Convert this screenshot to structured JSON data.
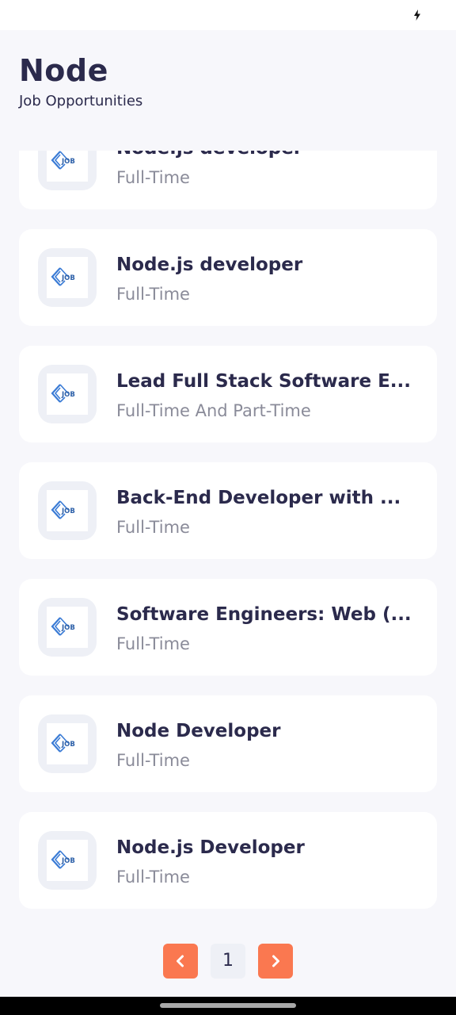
{
  "status_bar": {
    "icon": "charging-bolt-icon"
  },
  "header": {
    "title": "Node",
    "subtitle": "Job Opportunities"
  },
  "jobs": [
    {
      "title": "Node.js developer",
      "type": "Full-Time",
      "logo": "job-logo-icon"
    },
    {
      "title": "Node.js developer",
      "type": "Full-Time",
      "logo": "job-logo-icon"
    },
    {
      "title": "Lead Full Stack Software E...",
      "type": "Full-Time And Part-Time",
      "logo": "job-logo-icon"
    },
    {
      "title": "Back-End Developer with ...",
      "type": "Full-Time",
      "logo": "job-logo-icon"
    },
    {
      "title": "Software Engineers: Web (...",
      "type": "Full-Time",
      "logo": "job-logo-icon"
    },
    {
      "title": "Node Developer",
      "type": "Full-Time",
      "logo": "job-logo-icon"
    },
    {
      "title": "Node.js Developer",
      "type": "Full-Time",
      "logo": "job-logo-icon"
    }
  ],
  "pagination": {
    "current_page": "1",
    "prev_icon": "chevron-left-icon",
    "next_icon": "chevron-right-icon",
    "accent_color": "#fa7850"
  },
  "colors": {
    "background": "#f7f7fb",
    "card": "#ffffff",
    "text_primary": "#2b2a4c",
    "text_secondary": "#8a8b99"
  }
}
